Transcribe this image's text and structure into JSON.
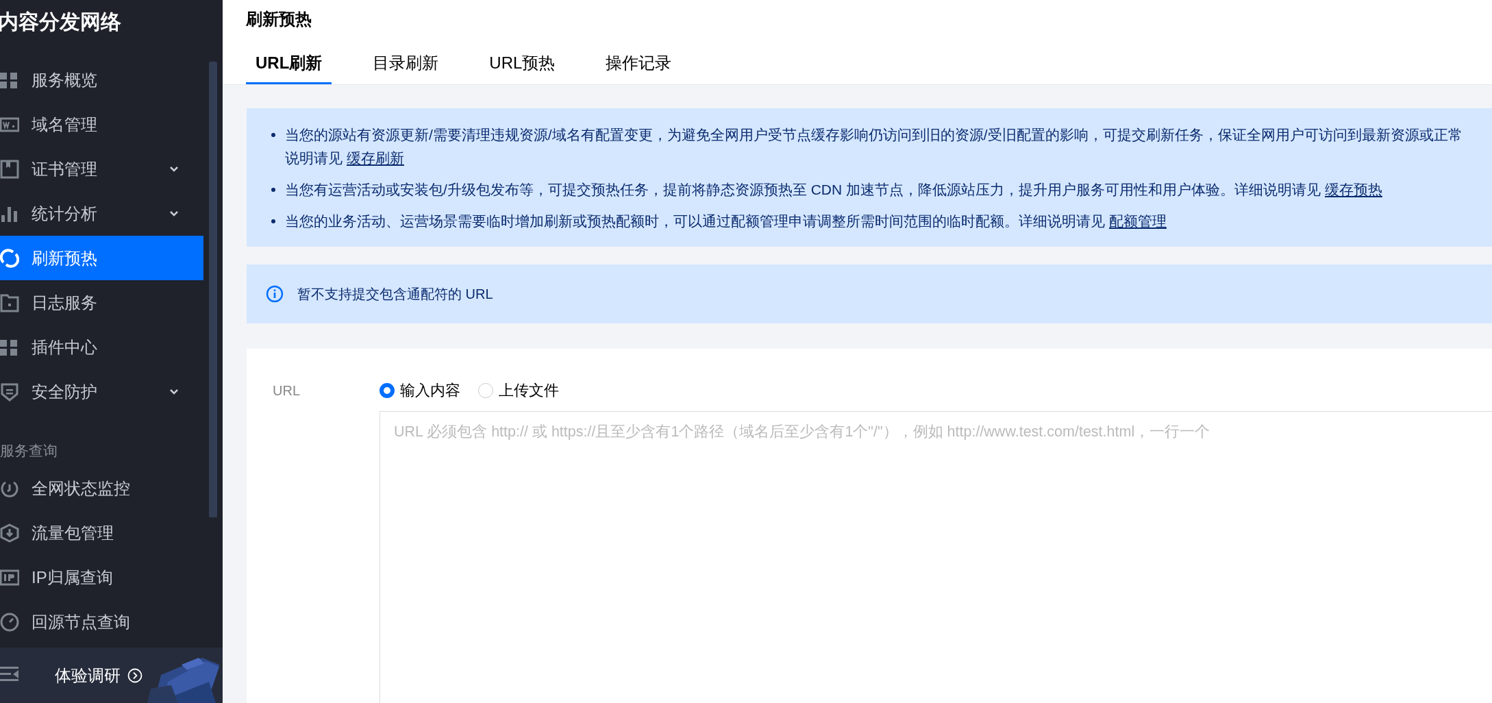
{
  "sidebar": {
    "title": "内容分发网络",
    "items": [
      {
        "label": "服务概览",
        "kind": "grid",
        "expandable": false,
        "selected": false
      },
      {
        "label": "域名管理",
        "kind": "domain",
        "expandable": false,
        "selected": false
      },
      {
        "label": "证书管理",
        "kind": "cert",
        "expandable": true,
        "selected": false
      },
      {
        "label": "统计分析",
        "kind": "chart",
        "expandable": true,
        "selected": false
      },
      {
        "label": "刷新预热",
        "kind": "refresh",
        "expandable": false,
        "selected": true
      },
      {
        "label": "日志服务",
        "kind": "folder",
        "expandable": false,
        "selected": false
      },
      {
        "label": "插件中心",
        "kind": "grid",
        "expandable": false,
        "selected": false
      },
      {
        "label": "安全防护",
        "kind": "shield",
        "expandable": true,
        "selected": false
      }
    ],
    "section": {
      "title": "服务查询",
      "items": [
        {
          "label": "全网状态监控",
          "kind": "monitor",
          "selected": false
        },
        {
          "label": "流量包管理",
          "kind": "package",
          "selected": false
        },
        {
          "label": "IP归属查询",
          "kind": "ip",
          "selected": false
        },
        {
          "label": "回源节点查询",
          "kind": "gauge",
          "selected": false
        }
      ]
    },
    "survey": {
      "label": "体验调研"
    }
  },
  "page": {
    "title": "刷新预热",
    "tabs": [
      {
        "label": "URL刷新",
        "selected": true
      },
      {
        "label": "目录刷新",
        "selected": false
      },
      {
        "label": "URL预热",
        "selected": false
      },
      {
        "label": "操作记录",
        "selected": false
      }
    ],
    "notes": [
      {
        "text": "当您的源站有资源更新/需要清理违规资源/域名有配置变更，为避免全网用户受节点缓存影响仍访问到旧的资源/受旧配置的影响，可提交刷新任务，保证全网用户可访问到最新资源或正常",
        "text_2": "说明请见",
        "link": "缓存刷新"
      },
      {
        "text": "当您有运营活动或安装包/升级包发布等，可提交预热任务，提前将静态资源预热至 CDN 加速节点，降低源站压力，提升用户服务可用性和用户体验。详细说明请见",
        "link": "缓存预热"
      },
      {
        "text": "当您的业务活动、运营场景需要临时增加刷新或预热配额时，可以通过配额管理申请调整所需时间范围的临时配额。详细说明请见",
        "link": "配额管理"
      }
    ],
    "alert": "暂不支持提交包含通配符的 URL",
    "form": {
      "label": "URL",
      "options": [
        {
          "label": "输入内容",
          "selected": true
        },
        {
          "label": "上传文件",
          "selected": false
        }
      ],
      "placeholder": "URL 必须包含 http:// 或 https://且至少含有1个路径（域名后至少含有1个\"/\"），例如 http://www.test.com/test.html，一行一个"
    }
  }
}
